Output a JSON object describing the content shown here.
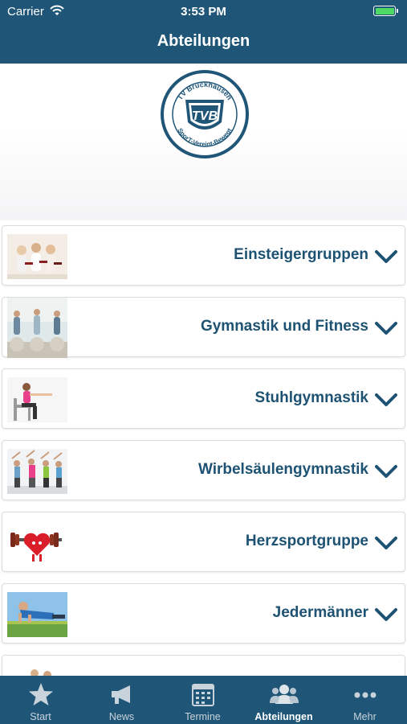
{
  "status_bar": {
    "carrier": "Carrier",
    "time": "3:53 PM"
  },
  "header": {
    "title": "Abteilungen"
  },
  "logo": {
    "text_top": "TV Bruckhausen",
    "text_bottom": "SporT-Vereint-Bewegt",
    "monogram": "TVB"
  },
  "departments": [
    {
      "label": "Einsteigergruppen",
      "thumb": "dumbbell-women-photo"
    },
    {
      "label": "Gymnastik und Fitness",
      "thumb": "gym-ball-class-photo"
    },
    {
      "label": "Stuhlgymnastik",
      "thumb": "chair-exercise-photo"
    },
    {
      "label": "Wirbelsäulengymnastik",
      "thumb": "stretching-group-photo"
    },
    {
      "label": "Herzsportgruppe",
      "thumb": "heart-dumbbell-photo"
    },
    {
      "label": "Jedermänner",
      "thumb": "pushup-man-photo"
    }
  ],
  "tabbar": {
    "items": [
      {
        "label": "Start",
        "icon": "star-icon"
      },
      {
        "label": "News",
        "icon": "megaphone-icon"
      },
      {
        "label": "Termine",
        "icon": "calendar-icon"
      },
      {
        "label": "Abteilungen",
        "icon": "group-icon",
        "active": true
      },
      {
        "label": "Mehr",
        "icon": "more-dots-icon"
      }
    ]
  },
  "colors": {
    "primary": "#1f5678",
    "label": "#1d5273",
    "battery": "#4cd964"
  }
}
